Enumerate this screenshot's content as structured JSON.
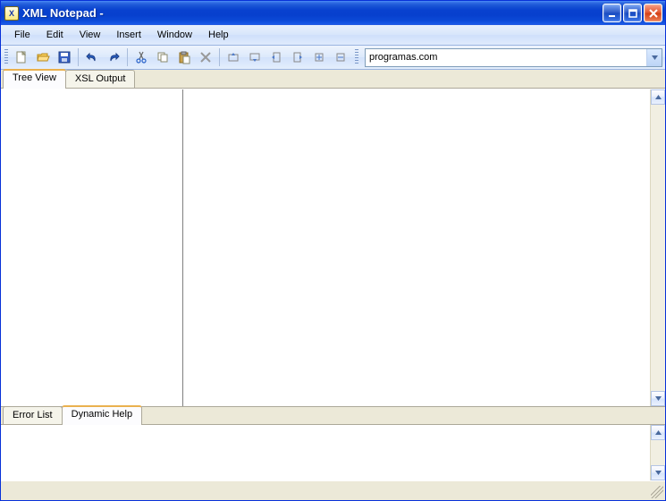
{
  "title": "XML Notepad -",
  "menu": {
    "file": "File",
    "edit": "Edit",
    "view": "View",
    "insert": "Insert",
    "window": "Window",
    "help": "Help"
  },
  "url": {
    "value": "programas.com"
  },
  "tabs_top": {
    "tree_view": "Tree View",
    "xsl_output": "XSL Output"
  },
  "tabs_bottom": {
    "error_list": "Error List",
    "dynamic_help": "Dynamic Help"
  },
  "toolbar_icons": {
    "new": "new-file-icon",
    "open": "open-folder-icon",
    "save": "save-icon",
    "undo": "undo-icon",
    "redo": "redo-icon",
    "cut": "cut-icon",
    "copy": "copy-icon",
    "paste": "paste-icon",
    "delete": "delete-icon",
    "nudge_up": "nudge-up-icon",
    "nudge_down": "nudge-down-icon",
    "nudge_left": "nudge-left-icon",
    "nudge_right": "nudge-right-icon",
    "expand": "expand-icon",
    "collapse": "collapse-icon"
  }
}
